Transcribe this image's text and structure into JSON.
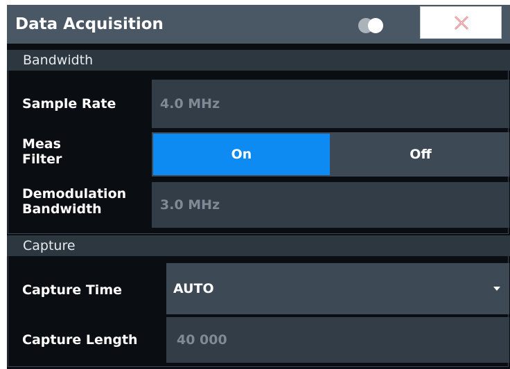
{
  "dialog": {
    "title": "Data Acquisition",
    "toggle_icon": "toggle-circles-icon",
    "close_icon": "close-x-icon"
  },
  "bandwidth": {
    "header": "Bandwidth",
    "sample_rate": {
      "label": "Sample Rate",
      "value": "4.0 MHz"
    },
    "meas_filter": {
      "label_line1": "Meas",
      "label_line2": "Filter",
      "on_label": "On",
      "off_label": "Off",
      "selected": "On"
    },
    "demod_bw": {
      "label_line1": "Demodulation",
      "label_line2": "Bandwidth",
      "value": "3.0 MHz"
    }
  },
  "capture": {
    "header": "Capture",
    "capture_time": {
      "label": "Capture Time",
      "value": "AUTO",
      "dropdown_icon": "triangle-down-icon"
    },
    "capture_length": {
      "label": "Capture Length",
      "value": "40 000"
    }
  },
  "colors": {
    "accent": "#0d8bf2",
    "title_bar": "#4a5866",
    "background": "#0a0d12",
    "field": "#323d48",
    "close_icon": "#e8565c"
  }
}
